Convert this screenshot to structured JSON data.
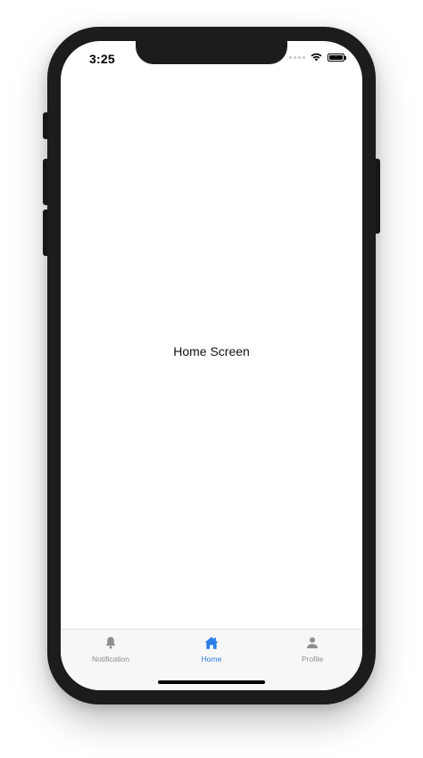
{
  "status_bar": {
    "time": "3:25",
    "wifi_icon": "wifi-icon",
    "battery_icon": "battery-icon",
    "battery_level": 1.0
  },
  "main": {
    "label": "Home Screen"
  },
  "tabbar": {
    "tabs": [
      {
        "label": "Notification",
        "icon": "bell-icon",
        "active": false
      },
      {
        "label": "Home",
        "icon": "home-icon",
        "active": true
      },
      {
        "label": "Profile",
        "icon": "person-icon",
        "active": false
      }
    ],
    "active_color": "#2b7de9",
    "inactive_color": "#8e8e93"
  }
}
